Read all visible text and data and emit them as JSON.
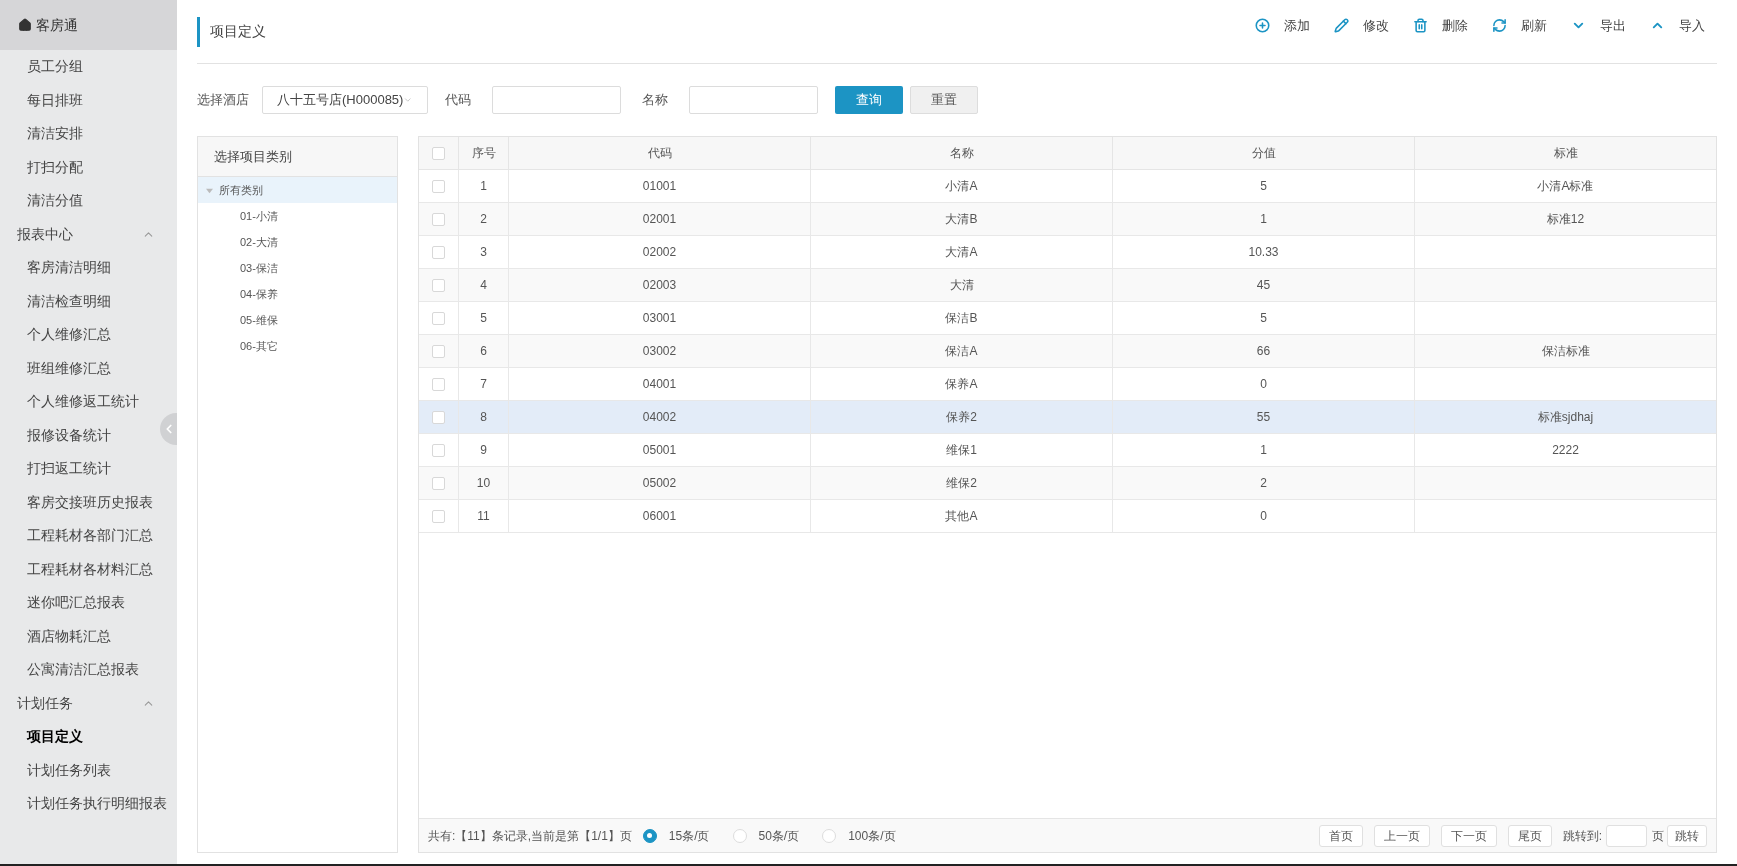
{
  "sidebar": {
    "title": "客房通",
    "groups": [
      {
        "items": [
          {
            "label": "员工分组",
            "selected": false
          },
          {
            "label": "每日排班",
            "selected": false
          },
          {
            "label": "清洁安排",
            "selected": false
          },
          {
            "label": "打扫分配",
            "selected": false
          },
          {
            "label": "清洁分值",
            "selected": false
          }
        ]
      },
      {
        "label": "报表中心",
        "expanded": true,
        "items": [
          {
            "label": "客房清洁明细",
            "selected": false
          },
          {
            "label": "清洁检查明细",
            "selected": false
          },
          {
            "label": "个人维修汇总",
            "selected": false
          },
          {
            "label": "班组维修汇总",
            "selected": false
          },
          {
            "label": "个人维修返工统计",
            "selected": false
          },
          {
            "label": "报修设备统计",
            "selected": false
          },
          {
            "label": "打扫返工统计",
            "selected": false
          },
          {
            "label": "客房交接班历史报表",
            "selected": false
          },
          {
            "label": "工程耗材各部门汇总",
            "selected": false
          },
          {
            "label": "工程耗材各材料汇总",
            "selected": false
          },
          {
            "label": "迷你吧汇总报表",
            "selected": false
          },
          {
            "label": "酒店物耗汇总",
            "selected": false
          },
          {
            "label": "公寓清洁汇总报表",
            "selected": false
          }
        ]
      },
      {
        "label": "计划任务",
        "expanded": true,
        "items": [
          {
            "label": "项目定义",
            "selected": true
          },
          {
            "label": "计划任务列表",
            "selected": false
          },
          {
            "label": "计划任务执行明细报表",
            "selected": false
          }
        ]
      }
    ]
  },
  "page_title": "项目定义",
  "toolbar": [
    {
      "label": "添加",
      "kind": "add"
    },
    {
      "label": "修改",
      "kind": "edit"
    },
    {
      "label": "删除",
      "kind": "delete"
    },
    {
      "label": "刷新",
      "kind": "refresh"
    },
    {
      "label": "导出",
      "kind": "down"
    },
    {
      "label": "导入",
      "kind": "up"
    }
  ],
  "filters": {
    "hotel_label": "选择酒店",
    "hotel_value": "八十五号店(H000085)",
    "code_label": "代码",
    "name_label": "名称",
    "search_button": "查询",
    "reset_button": "重置"
  },
  "tree": {
    "title": "选择项目类别",
    "root": {
      "label": "所有类别",
      "expanded": true,
      "selected": true,
      "children": [
        {
          "label": "01-小清"
        },
        {
          "label": "02-大清"
        },
        {
          "label": "03-保洁"
        },
        {
          "label": "04-保养"
        },
        {
          "label": "05-维保"
        },
        {
          "label": "06-其它"
        }
      ]
    }
  },
  "table": {
    "header_checked": false,
    "columns": [
      "序号",
      "代码",
      "名称",
      "分值",
      "标准"
    ],
    "rows": [
      {
        "checked": false,
        "highlighted": false,
        "cells": [
          "1",
          "01001",
          "小清A",
          "5",
          "小清A标准"
        ]
      },
      {
        "checked": false,
        "highlighted": false,
        "cells": [
          "2",
          "02001",
          "大清B",
          "1",
          "标准12"
        ]
      },
      {
        "checked": false,
        "highlighted": false,
        "cells": [
          "3",
          "02002",
          "大清A",
          "10.33",
          ""
        ]
      },
      {
        "checked": false,
        "highlighted": false,
        "cells": [
          "4",
          "02003",
          "大清",
          "45",
          ""
        ]
      },
      {
        "checked": false,
        "highlighted": false,
        "cells": [
          "5",
          "03001",
          "保洁B",
          "5",
          ""
        ]
      },
      {
        "checked": false,
        "highlighted": false,
        "cells": [
          "6",
          "03002",
          "保洁A",
          "66",
          "保洁标准"
        ]
      },
      {
        "checked": false,
        "highlighted": false,
        "cells": [
          "7",
          "04001",
          "保养A",
          "0",
          ""
        ]
      },
      {
        "checked": false,
        "highlighted": true,
        "cells": [
          "8",
          "04002",
          "保养2",
          "55",
          "标准sjdhaj"
        ]
      },
      {
        "checked": false,
        "highlighted": false,
        "cells": [
          "9",
          "05001",
          "维保1",
          "1",
          "2222"
        ]
      },
      {
        "checked": false,
        "highlighted": false,
        "cells": [
          "10",
          "05002",
          "维保2",
          "2",
          ""
        ]
      },
      {
        "checked": false,
        "highlighted": false,
        "cells": [
          "11",
          "06001",
          "其他A",
          "0",
          ""
        ]
      }
    ]
  },
  "pager": {
    "summary": "共有:【11】条记录,当前是第【1/1】页",
    "page_sizes": [
      {
        "label": "15条/页",
        "selected": true
      },
      {
        "label": "50条/页",
        "selected": false
      },
      {
        "label": "100条/页",
        "selected": false
      }
    ],
    "buttons": [
      "首页",
      "上一页",
      "下一页",
      "尾页"
    ],
    "jump_label": "跳转到:",
    "page_unit": "页",
    "jump_button": "跳转"
  }
}
